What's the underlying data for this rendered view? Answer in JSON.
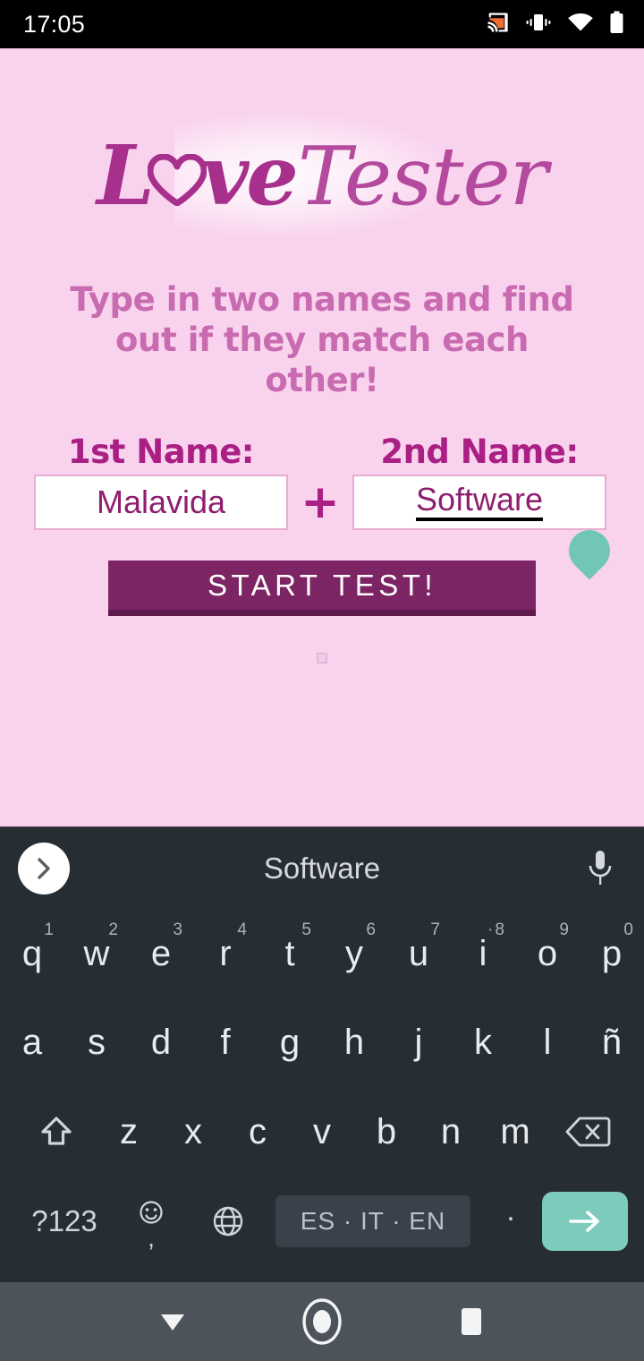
{
  "status_bar": {
    "time": "17:05",
    "icons": [
      "cast-icon",
      "vibrate-icon",
      "wifi-icon",
      "battery-icon"
    ]
  },
  "app": {
    "logo": {
      "part1": "L",
      "heart": "heart-icon",
      "part2": "ve",
      "part3": "Tester"
    },
    "tagline": "Type in two names and find out if they match each other!",
    "label_first": "1st Name:",
    "label_second": "2nd Name:",
    "value_first": "Malavida",
    "value_second": "Software",
    "plus": "+",
    "start_button": "START TEST!"
  },
  "keyboard": {
    "suggestion": "Software",
    "row1": [
      {
        "key": "q",
        "hint": "1"
      },
      {
        "key": "w",
        "hint": "2"
      },
      {
        "key": "e",
        "hint": "3"
      },
      {
        "key": "r",
        "hint": "4"
      },
      {
        "key": "t",
        "hint": "5"
      },
      {
        "key": "y",
        "hint": "6"
      },
      {
        "key": "u",
        "hint": "7"
      },
      {
        "key": "i",
        "hint": "8"
      },
      {
        "key": "o",
        "hint": "9"
      },
      {
        "key": "p",
        "hint": "0"
      }
    ],
    "row2": [
      "a",
      "s",
      "d",
      "f",
      "g",
      "h",
      "j",
      "k",
      "l",
      "ñ"
    ],
    "row3": [
      "z",
      "x",
      "c",
      "v",
      "b",
      "n",
      "m"
    ],
    "symbols_key": "?123",
    "comma_key": ",",
    "space_key": "ES · IT · EN",
    "period_key": ".",
    "enter_key": "enter-icon"
  },
  "navigation": {
    "back": "hide-keyboard-icon",
    "home": "home-icon",
    "recents": "recents-icon"
  },
  "colors": {
    "app_background": "#f9d2ee",
    "brand_magenta": "#aa1f84",
    "logo_purple": "#a6308c",
    "tagline_pink": "#c96bb0",
    "button_purple": "#7c2464",
    "keyboard_bg": "#272e33",
    "enter_teal": "#7ccbbd",
    "handle_teal": "#72c6b8",
    "nav_bg": "#4c535a"
  }
}
